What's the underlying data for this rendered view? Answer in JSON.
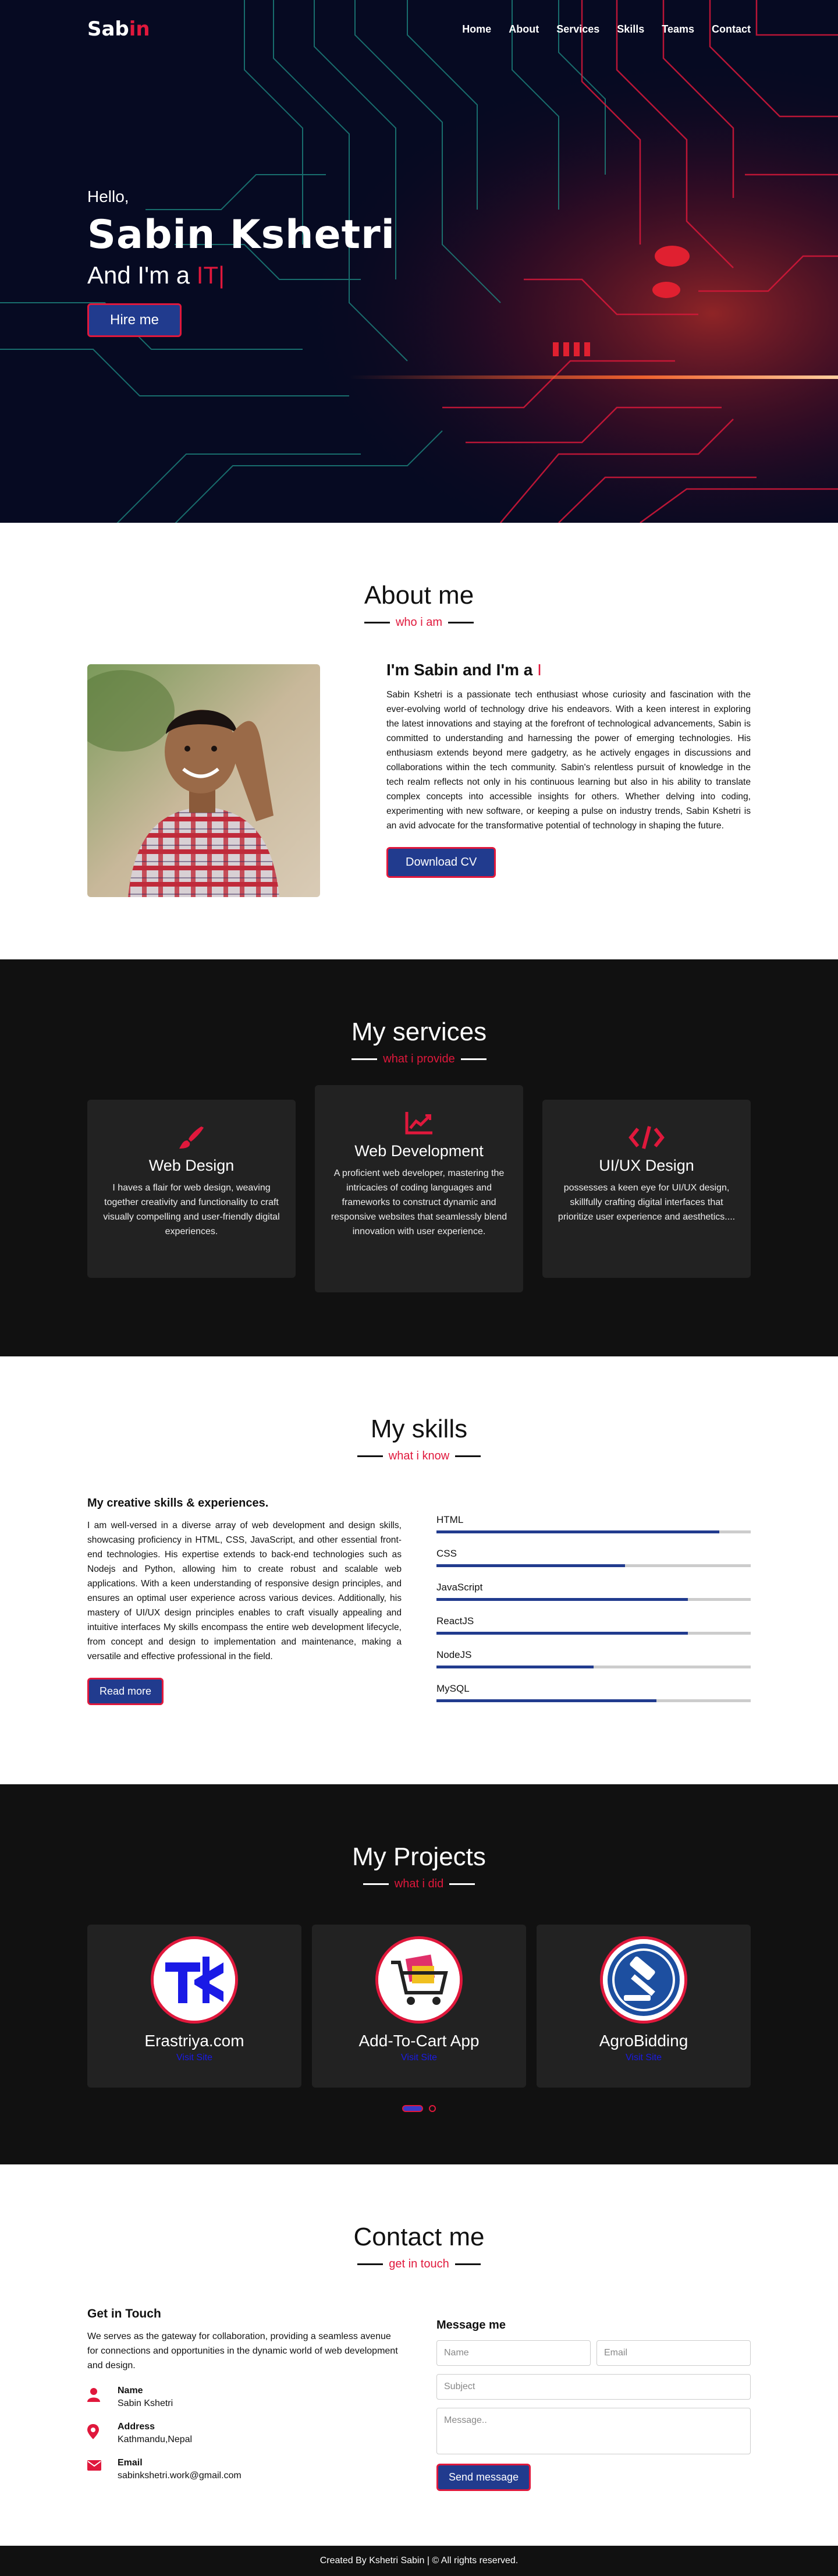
{
  "nav": {
    "logo_main": "Sab",
    "logo_accent": "in",
    "items": [
      "Home",
      "About",
      "Services",
      "Skills",
      "Teams",
      "Contact"
    ]
  },
  "hero": {
    "hello": "Hello,",
    "name": "Sabin Kshetri",
    "role_prefix": "And I'm a",
    "role_typed": "IT",
    "caret": "|",
    "button": "Hire me"
  },
  "about": {
    "title": "About me",
    "subtitle": "who i am",
    "heading": "I'm Sabin and I'm a",
    "heading_caret": "I",
    "paragraph": "Sabin Kshetri is a passionate tech enthusiast whose curiosity and fascination with the ever-evolving world of technology drive his endeavors. With a keen interest in exploring the latest innovations and staying at the forefront of technological advancements, Sabin is committed to understanding and harnessing the power of emerging technologies. His enthusiasm extends beyond mere gadgetry, as he actively engages in discussions and collaborations within the tech community. Sabin's relentless pursuit of knowledge in the tech realm reflects not only in his continuous learning but also in his ability to translate complex concepts into accessible insights for others. Whether delving into coding, experimenting with new software, or keeping a pulse on industry trends, Sabin Kshetri is an avid advocate for the transformative potential of technology in shaping the future.",
    "button": "Download CV"
  },
  "services": {
    "title": "My services",
    "subtitle": "what i provide",
    "cards": [
      {
        "icon": "paint-brush-icon",
        "name": "Web Design",
        "desc": "I haves a flair for web design, weaving together creativity and functionality to craft visually compelling and user-friendly digital experiences."
      },
      {
        "icon": "chart-line-icon",
        "name": "Web Development",
        "desc": "A proficient web developer, mastering the intricacies of coding languages and frameworks to construct dynamic and responsive websites that seamlessly blend innovation with user experience."
      },
      {
        "icon": "code-icon",
        "name": "UI/UX Design",
        "desc": "possesses a keen eye for UI/UX design, skillfully crafting digital interfaces that prioritize user experience and aesthetics...."
      }
    ]
  },
  "skills": {
    "title": "My skills",
    "subtitle": "what i know",
    "heading": "My creative skills & experiences.",
    "paragraph": "I am well-versed in a diverse array of web development and design skills, showcasing proficiency in HTML, CSS, JavaScript, and other essential front-end technologies. His expertise extends to back-end technologies such as Nodejs and Python, allowing him to create robust and scalable web applications. With a keen understanding of responsive design principles, and ensures an optimal user experience across various devices. Additionally, his mastery of UI/UX design principles enables to craft visually appealing and intuitive interfaces My skills encompass the entire web development lifecycle, from concept and design to implementation and maintenance, making a versatile and effective professional in the field.",
    "button": "Read more",
    "list": [
      {
        "name": "HTML",
        "level": 0.9
      },
      {
        "name": "CSS",
        "level": 0.6
      },
      {
        "name": "JavaScript",
        "level": 0.8
      },
      {
        "name": "ReactJS",
        "level": 0.8
      },
      {
        "name": "NodeJS",
        "level": 0.5
      },
      {
        "name": "MySQL",
        "level": 0.7
      }
    ]
  },
  "projects": {
    "title": "My Projects",
    "subtitle": "what i did",
    "items": [
      {
        "name": "Erastriya.com",
        "link": "Visit Site",
        "icon": "erastriya-logo-icon"
      },
      {
        "name": "Add-To-Cart App",
        "link": "Visit Site",
        "icon": "shopping-cart-icon"
      },
      {
        "name": "AgroBidding",
        "link": "Visit Site",
        "icon": "gavel-icon"
      }
    ]
  },
  "contact": {
    "title": "Contact me",
    "subtitle": "get in touch",
    "heading": "Get in Touch",
    "paragraph": "We serves as the gateway for collaboration, providing a seamless avenue for connections and opportunities in the dynamic world of web development and design.",
    "info": [
      {
        "icon": "user-icon",
        "label": "Name",
        "value": "Sabin Kshetri"
      },
      {
        "icon": "map-marker-icon",
        "label": "Address",
        "value": "Kathmandu,Nepal"
      },
      {
        "icon": "envelope-icon",
        "label": "Email",
        "value": "sabinkshetri.work@gmail.com"
      }
    ],
    "form_heading": "Message me",
    "form": {
      "name_placeholder": "Name",
      "email_placeholder": "Email",
      "subject_placeholder": "Subject",
      "message_placeholder": "Message..",
      "button": "Send message"
    }
  },
  "footer": {
    "text": "Created By Kshetri Sabin | © All rights reserved."
  },
  "colors": {
    "accent": "#e0183c",
    "primary_button": "#213b8e",
    "dark_bg": "#111111",
    "card_bg": "#222222",
    "hero_bg": "#060a22"
  }
}
